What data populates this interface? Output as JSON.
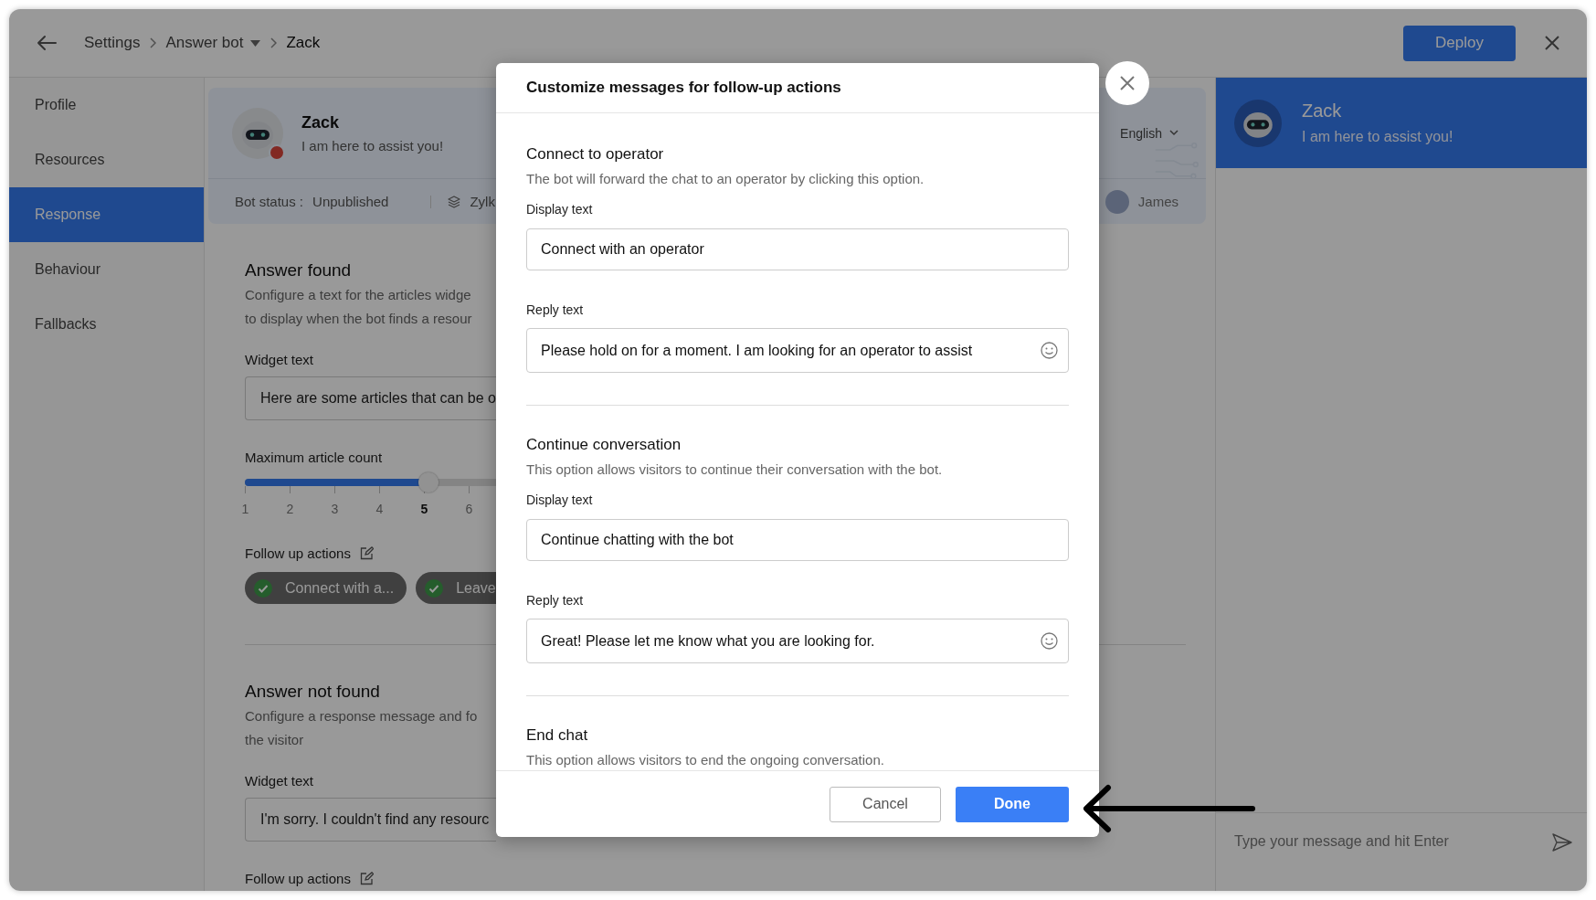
{
  "header": {
    "breadcrumbs": [
      {
        "label": "Settings",
        "kind": "link"
      },
      {
        "label": "Answer bot",
        "kind": "dropdown"
      },
      {
        "label": "Zack",
        "kind": "current"
      }
    ],
    "deploy_button": "Deploy"
  },
  "sidebar": {
    "items": [
      {
        "label": "Profile",
        "selected": false
      },
      {
        "label": "Resources",
        "selected": false
      },
      {
        "label": "Response",
        "selected": true
      },
      {
        "label": "Behaviour",
        "selected": false
      },
      {
        "label": "Fallbacks",
        "selected": false
      }
    ]
  },
  "bot_card": {
    "name": "Zack",
    "subtitle": "I am here to assist you!",
    "published": false,
    "status_label": "Bot status :",
    "status_value": "Unpublished",
    "brand": "Zylk",
    "language": "English",
    "owner": "James"
  },
  "answer_found": {
    "title": "Answer found",
    "description_lines": [
      "Configure a text for the articles widge",
      "to display when the bot finds a resour"
    ],
    "widget_label": "Widget text",
    "widget_value": "Here are some articles that can be o",
    "slider_label": "Maximum article count",
    "slider": {
      "level": 0.73
    },
    "ticks": [
      {
        "label": "1",
        "selected": false
      },
      {
        "label": "2",
        "selected": false
      },
      {
        "label": "3",
        "selected": false
      },
      {
        "label": "4",
        "selected": false
      },
      {
        "label": "5",
        "selected": true
      },
      {
        "label": "6",
        "selected": false
      }
    ],
    "follow_label": "Follow up actions",
    "chips": [
      {
        "label": "Connect with a...",
        "checked": true
      },
      {
        "label": "Leave",
        "checked": true
      }
    ]
  },
  "answer_not_found": {
    "title": "Answer not found",
    "description_lines": [
      "Configure a response message and fo",
      "the visitor"
    ],
    "widget_label": "Widget text",
    "widget_value": "I'm sorry. I couldn't find any resourc",
    "follow_label": "Follow up actions"
  },
  "preview": {
    "name": "Zack",
    "subtitle": "I am here to assist you!",
    "placeholder": "Type your message and hit Enter"
  },
  "modal": {
    "title": "Customize messages for follow-up actions",
    "sections": [
      {
        "title": "Connect to operator",
        "description": "The bot will forward the chat to an operator by clicking this option.",
        "fields": [
          {
            "label": "Display text",
            "value": "Connect with an operator",
            "kind": "plain"
          },
          {
            "label": "Reply text",
            "value": "Please hold on for a moment. I am looking for an operator to assist",
            "kind": "emoji"
          }
        ]
      },
      {
        "title": "Continue conversation",
        "description": "This option allows visitors to continue their conversation with the bot.",
        "fields": [
          {
            "label": "Display text",
            "value": "Continue chatting with the bot",
            "kind": "plain"
          },
          {
            "label": "Reply text",
            "value": "Great! Please let me know what you are looking for.",
            "kind": "emoji"
          }
        ]
      },
      {
        "title": "End chat",
        "description": "This option allows visitors to end the ongoing conversation."
      }
    ],
    "cancel_button": "Cancel",
    "done_button": "Done"
  }
}
